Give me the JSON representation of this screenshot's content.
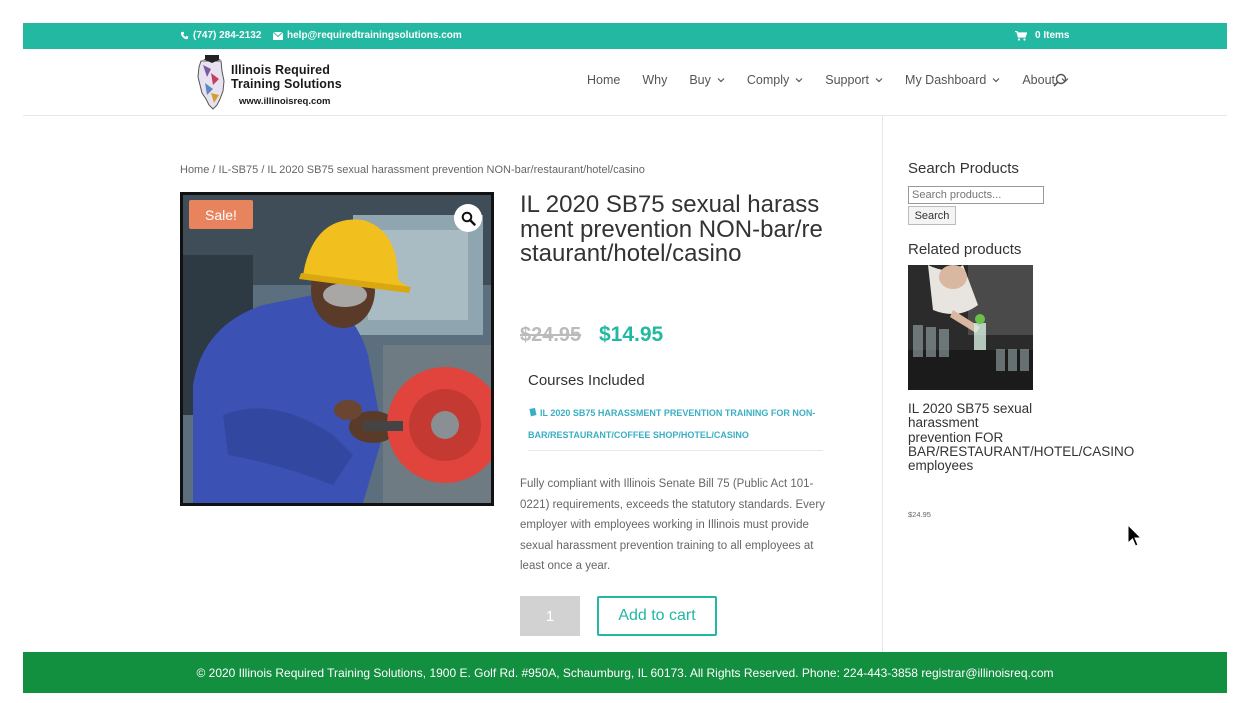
{
  "topbar": {
    "phone": "(747) 284-2132",
    "email": "help@requiredtrainingsolutions.com",
    "cart": "0 Items"
  },
  "logo": {
    "line1": "Illinois Required",
    "line2": "Training Solutions",
    "url": "www.illinoisreq.com"
  },
  "nav": {
    "items": [
      {
        "label": "Home",
        "has_submenu": false
      },
      {
        "label": "Why",
        "has_submenu": false
      },
      {
        "label": "Buy",
        "has_submenu": true
      },
      {
        "label": "Comply",
        "has_submenu": true
      },
      {
        "label": "Support",
        "has_submenu": true
      },
      {
        "label": "My Dashboard",
        "has_submenu": true
      },
      {
        "label": "About",
        "has_submenu": true
      }
    ]
  },
  "breadcrumb": "Home / IL-SB75 / IL 2020 SB75 sexual harassment prevention NON-bar/restaurant/hotel/casino",
  "product": {
    "sale_badge": "Sale!",
    "title": "IL 2020 SB75 sexual harassment prevention NON-bar/restaurant/hotel/casino",
    "price_old": "$24.95",
    "price_new": "$14.95",
    "courses_heading": "Courses Included",
    "course_link": "IL 2020 SB75 HARASSMENT PREVENTION TRAINING FOR NON-BAR/RESTAURANT/COFFEE SHOP/HOTEL/CASINO",
    "description": "Fully compliant with Illinois Senate Bill 75 (Public Act 101-0221) requirements, exceeds the statutory standards. Every employer with employees working in Illinois must provide sexual harassment prevention training to all employees at least once a year.",
    "quantity": "1",
    "add_to_cart": "Add to cart"
  },
  "sidebar": {
    "search_title": "Search Products",
    "search_placeholder": "Search products...",
    "search_button": "Search",
    "related_title": "Related products",
    "related_item_title": "IL 2020 SB75 sexual harassment prevention FOR BAR/RESTAURANT/HOTEL/CASINO employees",
    "related_item_price": "$24.95"
  },
  "footer": {
    "text": "© 2020 Illinois Required Training Solutions, 1900 E. Golf Rd. #950A, Schaumburg, IL 60173. All Rights Reserved. Phone: 224-443-3858 registrar@illinoisreq.com"
  },
  "colors": {
    "accent": "#22b8a2",
    "footer": "#138f40",
    "sale": "#e8845d",
    "link": "#3aafc4"
  }
}
